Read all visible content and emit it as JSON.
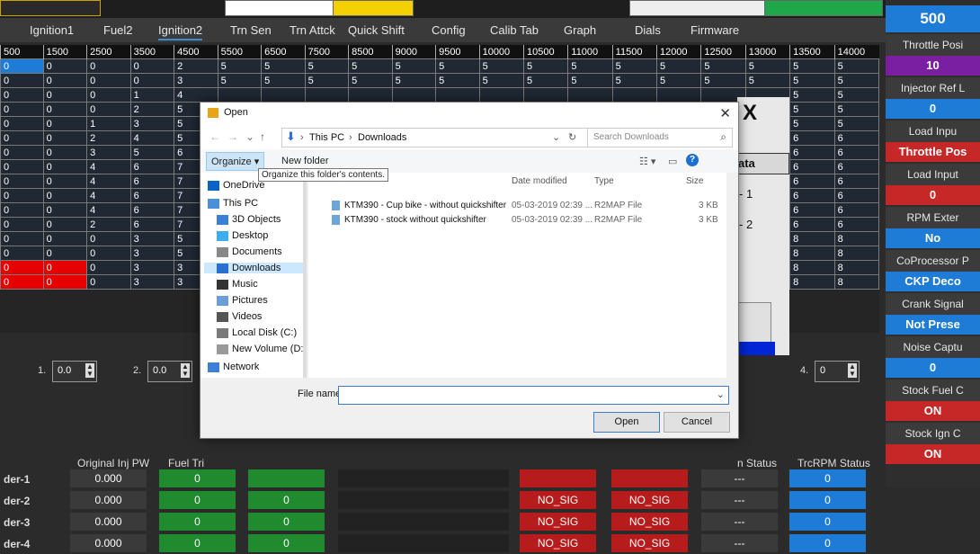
{
  "top_strip": {
    "buttons": [
      "",
      "",
      "",
      ""
    ]
  },
  "tabs": [
    "Ignition1",
    "Fuel2",
    "Ignition2",
    "Trn Sen",
    "Trn Attck",
    "Quick Shift",
    "Config",
    "Calib Tab",
    "Graph",
    "Dials",
    "Firmware"
  ],
  "active_tab": "Ignition2",
  "grid": {
    "headers": [
      "500",
      "1500",
      "2500",
      "3500",
      "4500",
      "5500",
      "6500",
      "7500",
      "8500",
      "9000",
      "9500",
      "10000",
      "10500",
      "11000",
      "11500",
      "12000",
      "12500",
      "13000",
      "13500",
      "14000"
    ],
    "rows": [
      [
        "0",
        "0",
        "0",
        "0",
        "2",
        "5",
        "5",
        "5",
        "5",
        "5",
        "5",
        "5",
        "5",
        "5",
        "5",
        "5",
        "5",
        "5",
        "5",
        "5"
      ],
      [
        "0",
        "0",
        "0",
        "0",
        "3",
        "5",
        "5",
        "5",
        "5",
        "5",
        "5",
        "5",
        "5",
        "5",
        "5",
        "5",
        "5",
        "5",
        "5",
        "5"
      ],
      [
        "0",
        "0",
        "0",
        "1",
        "4",
        "",
        "",
        "",
        "",
        "",
        "",
        "",
        "",
        "",
        "",
        "",
        "",
        "",
        "5",
        "5"
      ],
      [
        "0",
        "0",
        "0",
        "2",
        "5",
        "",
        "",
        "",
        "",
        "",
        "",
        "",
        "",
        "",
        "",
        "",
        "",
        "",
        "5",
        "5"
      ],
      [
        "0",
        "0",
        "1",
        "3",
        "5",
        "",
        "",
        "",
        "",
        "",
        "",
        "",
        "",
        "",
        "",
        "",
        "",
        "",
        "5",
        "5"
      ],
      [
        "0",
        "0",
        "2",
        "4",
        "5",
        "",
        "",
        "",
        "",
        "",
        "",
        "",
        "",
        "",
        "",
        "",
        "",
        "",
        "6",
        "6"
      ],
      [
        "0",
        "0",
        "3",
        "5",
        "6",
        "",
        "",
        "",
        "",
        "",
        "",
        "",
        "",
        "",
        "",
        "",
        "",
        "",
        "6",
        "6"
      ],
      [
        "0",
        "0",
        "4",
        "6",
        "7",
        "",
        "",
        "",
        "",
        "",
        "",
        "",
        "",
        "",
        "",
        "",
        "",
        "",
        "6",
        "6"
      ],
      [
        "0",
        "0",
        "4",
        "6",
        "7",
        "",
        "",
        "",
        "",
        "",
        "",
        "",
        "",
        "",
        "",
        "",
        "",
        "",
        "6",
        "6"
      ],
      [
        "0",
        "0",
        "4",
        "6",
        "7",
        "",
        "",
        "",
        "",
        "",
        "",
        "",
        "",
        "",
        "",
        "",
        "",
        "",
        "6",
        "6"
      ],
      [
        "0",
        "0",
        "4",
        "6",
        "7",
        "",
        "",
        "",
        "",
        "",
        "",
        "",
        "",
        "",
        "",
        "",
        "",
        "",
        "6",
        "6"
      ],
      [
        "0",
        "0",
        "2",
        "6",
        "7",
        "",
        "",
        "",
        "",
        "",
        "",
        "",
        "",
        "",
        "",
        "",
        "",
        "",
        "6",
        "6"
      ],
      [
        "0",
        "0",
        "0",
        "3",
        "5",
        "",
        "",
        "",
        "",
        "",
        "",
        "",
        "",
        "",
        "",
        "",
        "",
        "",
        "8",
        "8"
      ],
      [
        "0",
        "0",
        "0",
        "3",
        "5",
        "",
        "",
        "",
        "",
        "",
        "",
        "",
        "",
        "",
        "",
        "",
        "",
        "",
        "8",
        "8"
      ],
      [
        "0",
        "0",
        "0",
        "3",
        "3",
        "",
        "",
        "",
        "",
        "",
        "",
        "",
        "",
        "",
        "",
        "",
        "",
        "",
        "8",
        "8"
      ],
      [
        "0",
        "0",
        "0",
        "3",
        "3",
        "",
        "",
        "",
        "",
        "",
        "",
        "",
        "",
        "",
        "",
        "",
        "",
        "",
        "8",
        "8"
      ]
    ]
  },
  "behind_dialog": {
    "close": "X",
    "data_label": "ata",
    "line1": "- 1",
    "line2": "- 2"
  },
  "inputs": [
    {
      "label": "1.",
      "value": "0.0"
    },
    {
      "label": "2.",
      "value": "0.0"
    },
    {
      "label": "4.",
      "value": "0"
    }
  ],
  "status_headers": [
    "Original Inj PW",
    "Fuel Tri",
    "n Status",
    "TrcRPM Status"
  ],
  "status_rows": [
    {
      "label": "der-1",
      "inj": "0.000",
      "fuel": "0",
      "c4": "",
      "s1": "",
      "s2": "",
      "s3": "---",
      "trc": "0"
    },
    {
      "label": "der-2",
      "inj": "0.000",
      "fuel": "0",
      "c4": "0",
      "s1": "NO_SIG",
      "s2": "NO_SIG",
      "s3": "---",
      "trc": "0"
    },
    {
      "label": "der-3",
      "inj": "0.000",
      "fuel": "0",
      "c4": "0",
      "s1": "NO_SIG",
      "s2": "NO_SIG",
      "s3": "---",
      "trc": "0"
    },
    {
      "label": "der-4",
      "inj": "0.000",
      "fuel": "0",
      "c4": "0",
      "s1": "NO_SIG",
      "s2": "NO_SIG",
      "s3": "---",
      "trc": "0"
    }
  ],
  "sidebar": [
    {
      "label": "",
      "value": "500",
      "color": "#1e7bd6"
    },
    {
      "label": "Throttle Posi",
      "value": "10",
      "color": "#7b1fa2"
    },
    {
      "label": "Injector Ref L",
      "value": "0",
      "color": "#1e7bd6"
    },
    {
      "label": "Load Inpu",
      "value": "Throttle Pos",
      "color": "#c62828"
    },
    {
      "label": "Load Input",
      "value": "0",
      "color": "#c62828"
    },
    {
      "label": "RPM Exter",
      "value": "No",
      "color": "#1e7bd6"
    },
    {
      "label": "CoProcessor P",
      "value": "CKP Deco",
      "color": "#1e7bd6"
    },
    {
      "label": "Crank Signal",
      "value": "Not Prese",
      "color": "#1e7bd6"
    },
    {
      "label": "Noise Captu",
      "value": "0",
      "color": "#1e7bd6"
    },
    {
      "label": "Stock Fuel C",
      "value": "ON",
      "color": "#c62828"
    },
    {
      "label": "Stock Ign C",
      "value": "ON",
      "color": "#c62828"
    }
  ],
  "dialog": {
    "title": "Open",
    "close": "✕",
    "path": [
      "This PC",
      "Downloads"
    ],
    "search_placeholder": "Search Downloads",
    "organize": "Organize ▾",
    "new_folder": "New folder",
    "tooltip": "Organize this folder's contents.",
    "nav_items": [
      "OneDrive",
      "This PC",
      "3D Objects",
      "Desktop",
      "Documents",
      "Downloads",
      "Music",
      "Pictures",
      "Videos",
      "Local Disk (C:)",
      "New Volume (D:",
      "Network"
    ],
    "columns": [
      "Date modified",
      "Type",
      "Size"
    ],
    "files": [
      {
        "name": "KTM390 - Cup bike - without quickshifter",
        "date": "05-03-2019 02:39 ...",
        "type": "R2MAP File",
        "size": "3 KB"
      },
      {
        "name": "KTM390 - stock without quickshifter",
        "date": "05-03-2019 02:39 ...",
        "type": "R2MAP File",
        "size": "3 KB"
      }
    ],
    "file_name_label": "File name:",
    "open_label": "Open",
    "cancel_label": "Cancel"
  }
}
